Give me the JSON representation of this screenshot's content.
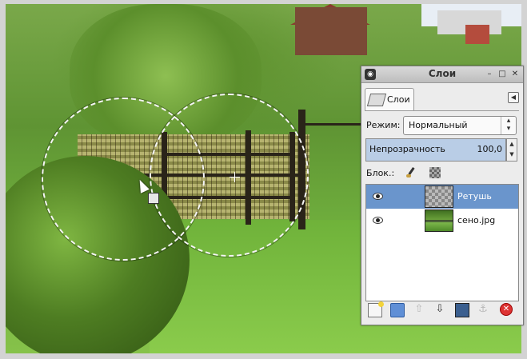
{
  "dialog": {
    "title": "Слои",
    "app_icon": "gimp-icon",
    "tab_label": "Слои",
    "mode_label": "Режим:",
    "mode_value": "Нормальный",
    "opacity_label": "Непрозрачность",
    "opacity_value": "100,0",
    "lock_label": "Блок.:",
    "layers": [
      {
        "name": "Ретушь",
        "visible": true,
        "selected": true,
        "thumbnail": "transparent"
      },
      {
        "name": "сено.jpg",
        "visible": true,
        "selected": false,
        "thumbnail": "photo"
      }
    ]
  },
  "colors": {
    "selection_row": "#6a95cc",
    "opacity_bar": "#c7d9ee",
    "delete_button": "#dd3333"
  }
}
